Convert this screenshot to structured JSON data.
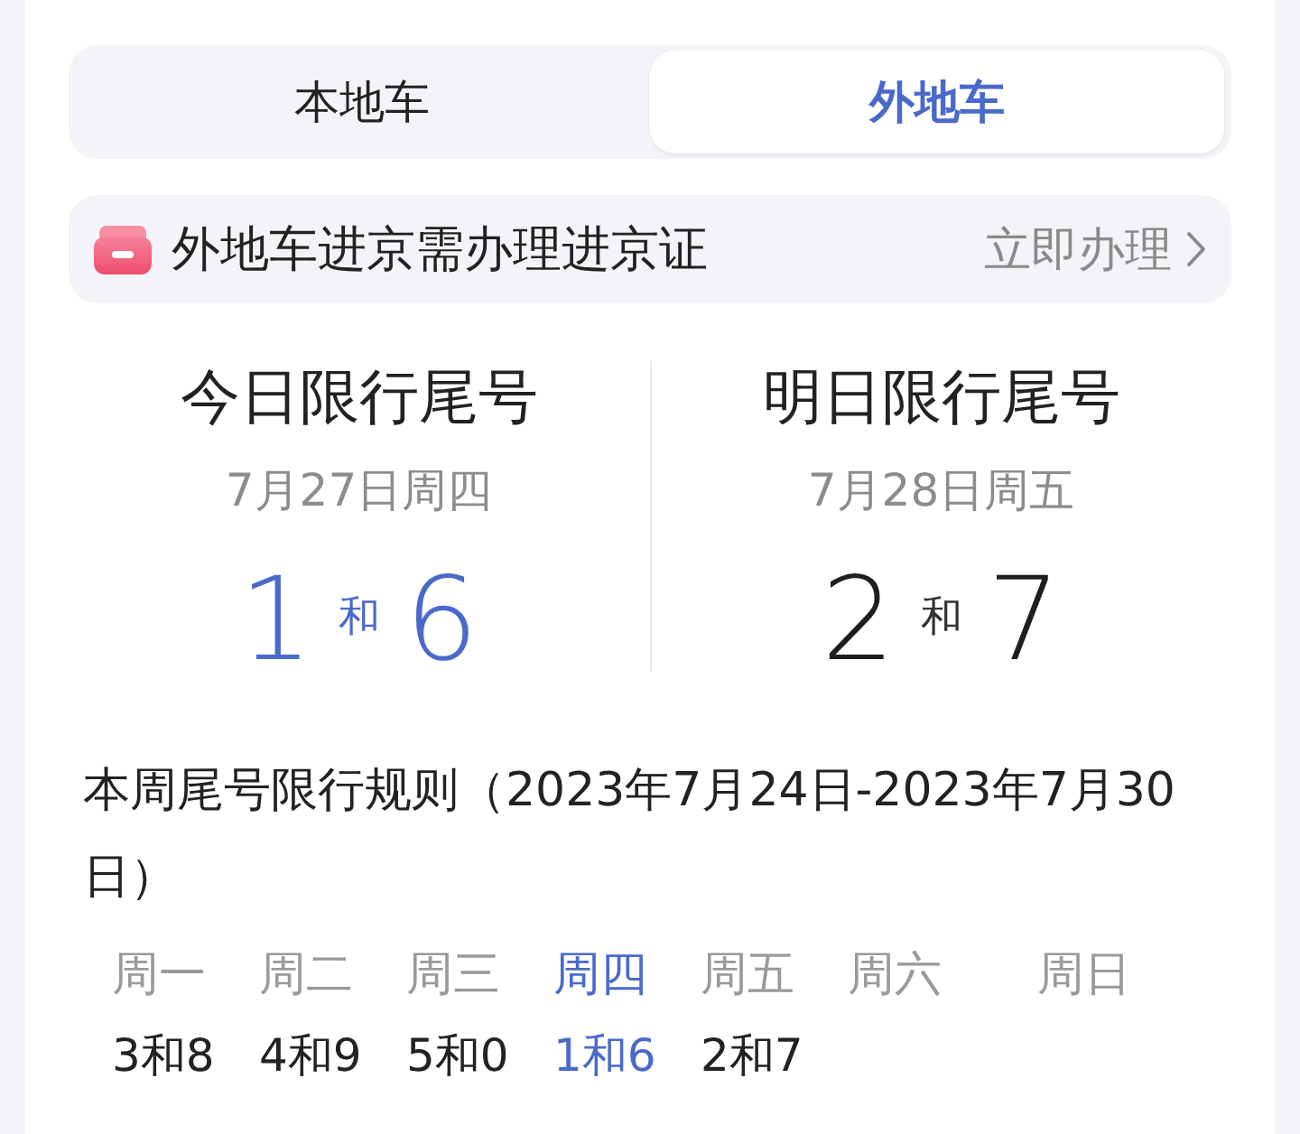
{
  "tabs": [
    {
      "label": "本地车",
      "selected": false
    },
    {
      "label": "外地车",
      "selected": true
    }
  ],
  "notice": {
    "text": "外地车进京需办理进京证",
    "action": "立即办理"
  },
  "restrictions": [
    {
      "title": "今日限行尾号",
      "date": "7月27日周四",
      "numbers": [
        "1",
        "6"
      ],
      "joiner": "和",
      "highlighted": true
    },
    {
      "title": "明日限行尾号",
      "date": "7月28日周五",
      "numbers": [
        "2",
        "7"
      ],
      "joiner": "和",
      "highlighted": false
    }
  ],
  "weekly_rules": {
    "title": "本周尾号限行规则（2023年7月24日-2023年7月30日）",
    "days": [
      {
        "label": "周一",
        "numbers": "3和8",
        "selected": false
      },
      {
        "label": "周二",
        "numbers": "4和9",
        "selected": false
      },
      {
        "label": "周三",
        "numbers": "5和0",
        "selected": false
      },
      {
        "label": "周四",
        "numbers": "1和6",
        "selected": true
      },
      {
        "label": "周五",
        "numbers": "2和7",
        "selected": false
      },
      {
        "label": "周六",
        "selected": false
      },
      {
        "label": "周日",
        "selected": false
      }
    ]
  }
}
